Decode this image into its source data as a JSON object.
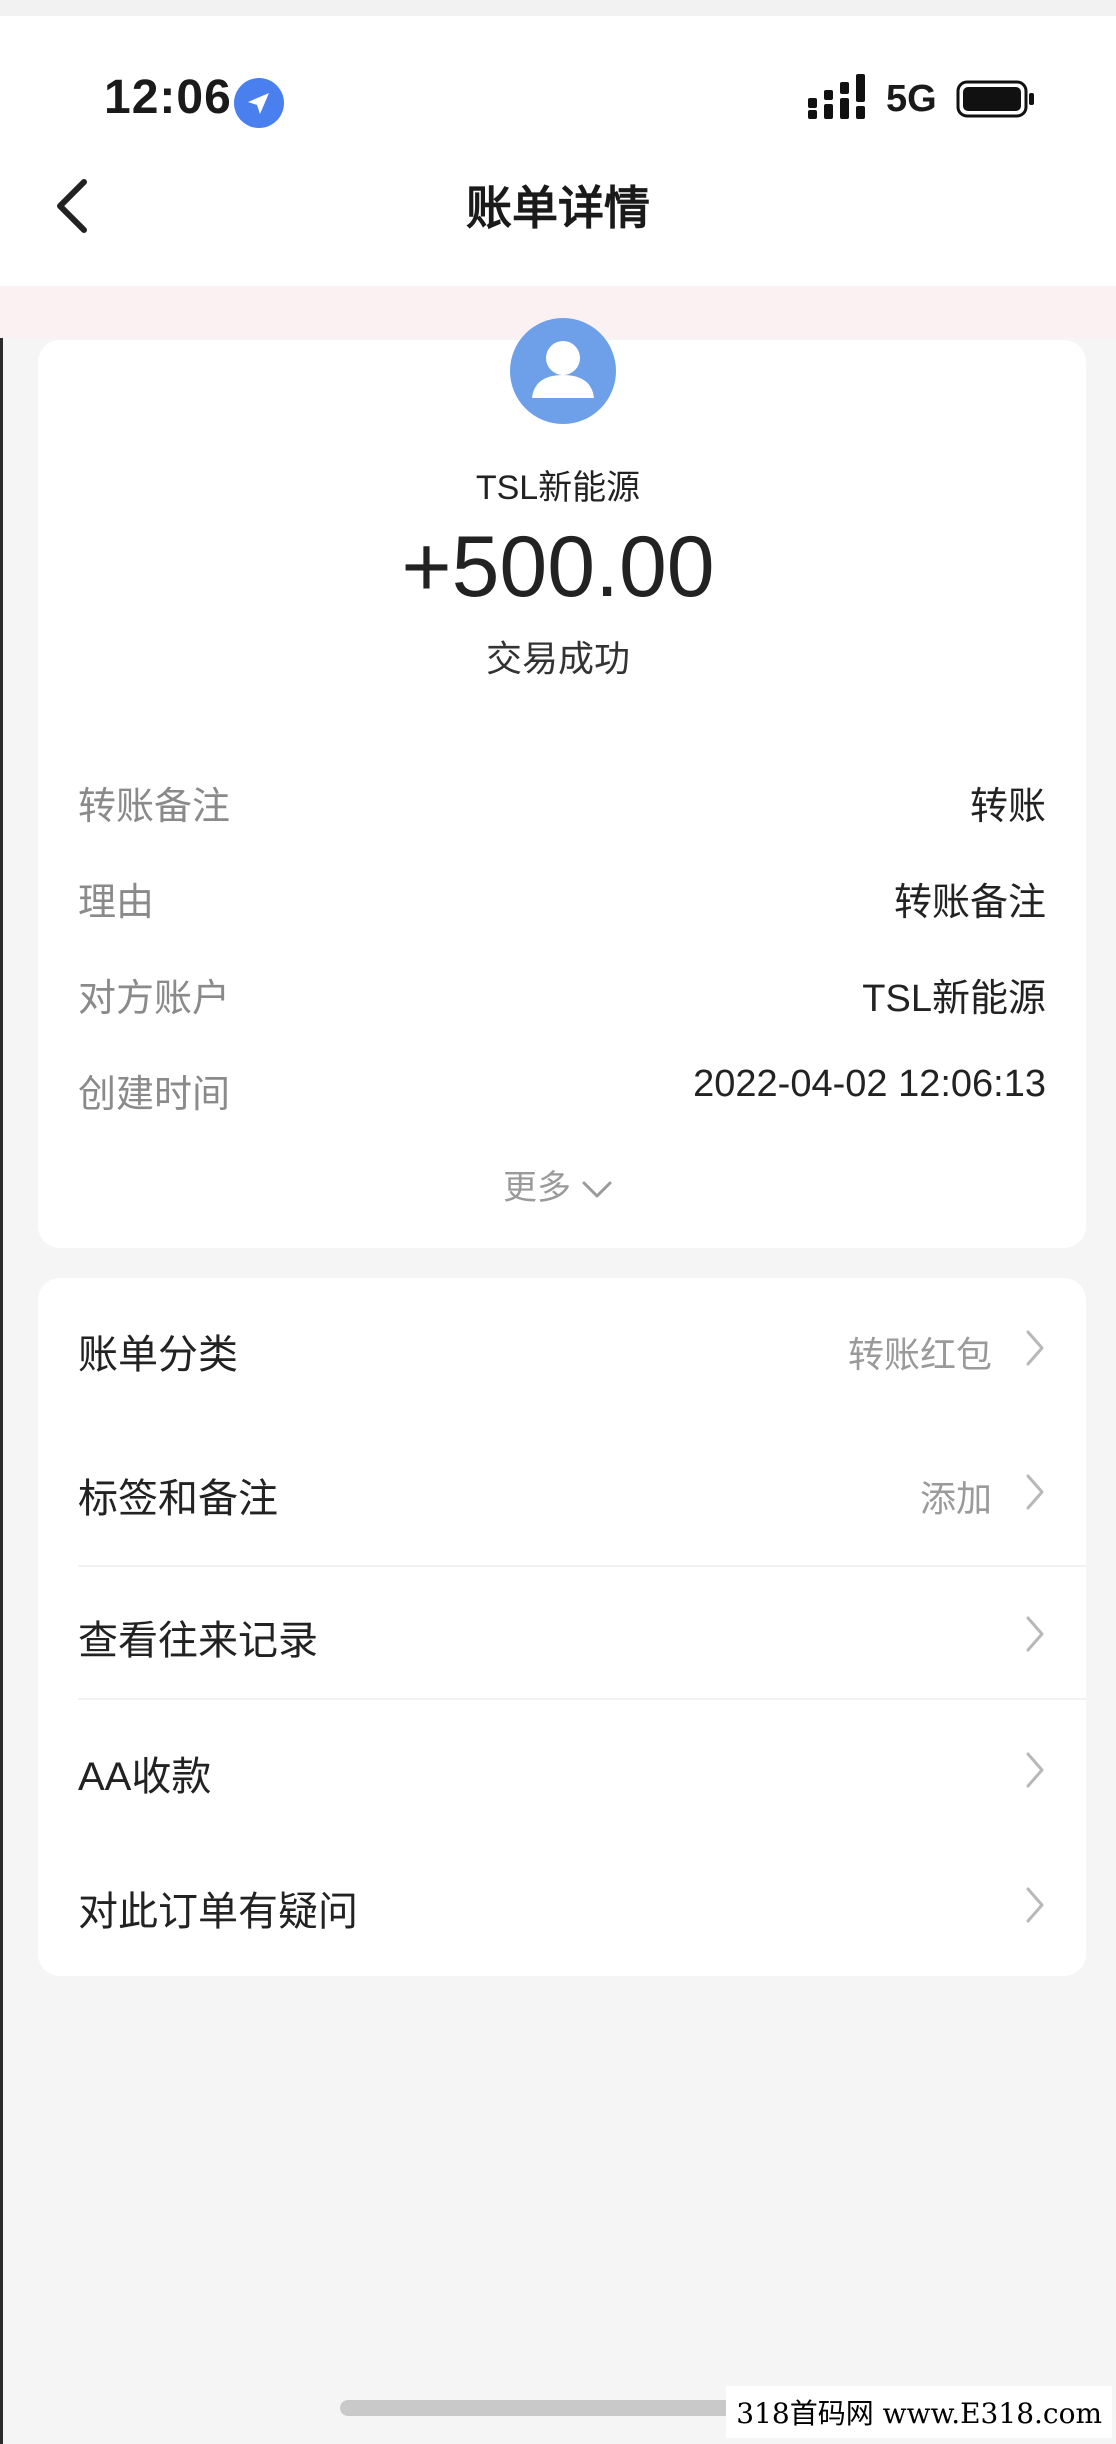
{
  "status_bar": {
    "time": "12:06",
    "network": "5G",
    "icons": [
      "location-icon",
      "signal-icon",
      "battery-icon"
    ]
  },
  "nav": {
    "title": "账单详情",
    "back_icon": "chevron-left-icon"
  },
  "summary": {
    "avatar_icon": "person-avatar-icon",
    "payee": "TSL新能源",
    "amount": "+500.00",
    "status": "交易成功"
  },
  "details": [
    {
      "label": "转账备注",
      "value": "转账"
    },
    {
      "label": "理由",
      "value": "转账备注"
    },
    {
      "label": "对方账户",
      "value": "TSL新能源"
    },
    {
      "label": "创建时间",
      "value": "2022-04-02 12:06:13"
    }
  ],
  "more_label": "更多",
  "menu": [
    {
      "label": "账单分类",
      "value": "转账红包"
    },
    {
      "label": "标签和备注",
      "value": "添加"
    },
    {
      "label": "查看往来记录",
      "value": ""
    },
    {
      "label": "AA收款",
      "value": ""
    },
    {
      "label": "对此订单有疑问",
      "value": ""
    }
  ],
  "watermark": "318首码网 www.E318.com",
  "colors": {
    "avatar": "#6ea0ea",
    "location": "#4a7ff0",
    "background": "#f5f5f5",
    "card": "#ffffff",
    "muted_text": "#8a8a8a"
  }
}
